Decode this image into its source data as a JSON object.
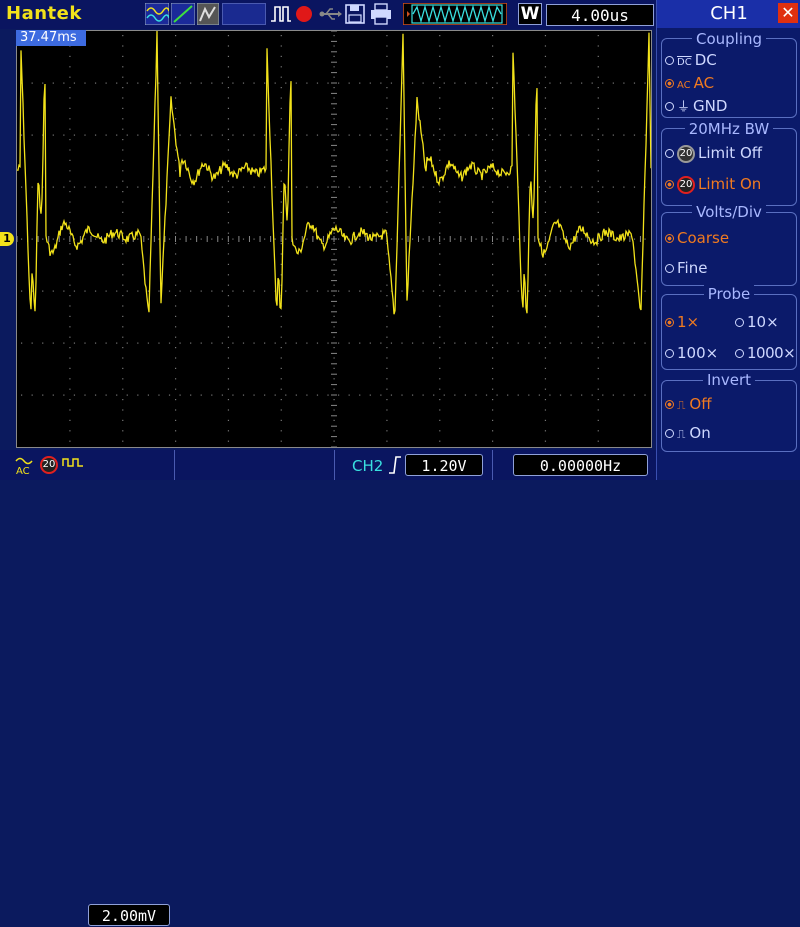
{
  "header": {
    "brand": "Hantek",
    "timebase": "4.00us",
    "mode_letter": "W",
    "trigger_time": "37.47ms"
  },
  "channel_marker": "1",
  "bottom": {
    "ch1_volts": "2.00mV",
    "ch2_label": "CH2",
    "ch2_level": "1.20V",
    "frequency": "0.00000Hz",
    "bw_badge": "20"
  },
  "panel": {
    "title": "CH1",
    "coupling": {
      "title": "Coupling",
      "options": [
        {
          "label": "DC",
          "selected": false
        },
        {
          "label": "AC",
          "selected": true
        },
        {
          "label": "GND",
          "selected": false
        }
      ]
    },
    "bw": {
      "title": "20MHz BW",
      "options": [
        {
          "label": "Limit Off",
          "badge": "20",
          "selected": false
        },
        {
          "label": "Limit On",
          "badge": "20",
          "selected": true
        }
      ]
    },
    "volts_div": {
      "title": "Volts/Div",
      "options": [
        {
          "label": "Coarse",
          "selected": true
        },
        {
          "label": "Fine",
          "selected": false
        }
      ]
    },
    "probe": {
      "title": "Probe",
      "options": [
        {
          "label": "1×",
          "selected": true
        },
        {
          "label": "10×",
          "selected": false
        },
        {
          "label": "100×",
          "selected": false
        },
        {
          "label": "1000×",
          "selected": false
        }
      ]
    },
    "invert": {
      "title": "Invert",
      "options": [
        {
          "label": "Off",
          "selected": true
        },
        {
          "label": "On",
          "selected": false
        }
      ]
    }
  },
  "colors": {
    "trace": "#f2e21a",
    "accent": "#f07a20",
    "panel_bg": "#0b1a6a"
  }
}
